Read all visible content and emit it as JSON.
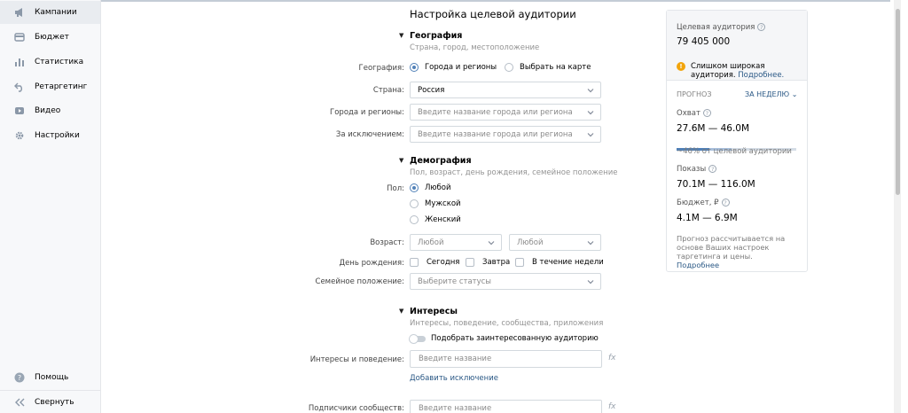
{
  "sidebar": {
    "items": [
      {
        "label": "Кампании",
        "icon": "megaphone-icon"
      },
      {
        "label": "Бюджет",
        "icon": "wallet-icon"
      },
      {
        "label": "Статистика",
        "icon": "bar-chart-icon"
      },
      {
        "label": "Ретаргетинг",
        "icon": "retarget-icon"
      },
      {
        "label": "Видео",
        "icon": "video-icon"
      },
      {
        "label": "Настройки",
        "icon": "gear-icon"
      }
    ],
    "help": "Помощь",
    "collapse": "Свернуть"
  },
  "page_title": "Настройка целевой аудитории",
  "geo": {
    "title": "География",
    "subtitle": "Страна, город, местоположение",
    "geo_label": "География:",
    "option_regions": "Города и регионы",
    "option_map": "Выбрать на карте",
    "country_label": "Страна:",
    "country_value": "Россия",
    "cities_label": "Города и регионы:",
    "cities_placeholder": "Введите название города или региона",
    "exclude_label": "За исключением:",
    "exclude_placeholder": "Введите название города или региона"
  },
  "demo": {
    "title": "Демография",
    "subtitle": "Пол, возраст, день рождения, семейное положение",
    "gender_label": "Пол:",
    "gender_any": "Любой",
    "gender_male": "Мужской",
    "gender_female": "Женский",
    "age_label": "Возраст:",
    "age_from": "Любой",
    "age_to": "Любой",
    "birthday_label": "День рождения:",
    "bday_today": "Сегодня",
    "bday_tomorrow": "Завтра",
    "bday_week": "В течение недели",
    "family_label": "Семейное положение:",
    "family_placeholder": "Выберите статусы"
  },
  "interests": {
    "title": "Интересы",
    "subtitle": "Интересы, поведение, сообщества, приложения",
    "toggle_label": "Подобрать заинтересованную аудиторию",
    "behavior_label": "Интересы и поведение:",
    "behavior_placeholder": "Введите название",
    "add_exclusion": "Добавить исключение",
    "subscribers_label": "Подписчики сообществ:",
    "subscribers_placeholder": "Введите название",
    "fx": "fx"
  },
  "panel": {
    "audience_label": "Целевая аудитория",
    "audience_value": "79 405 000",
    "warning_text": "Слишком широкая аудитория.",
    "warning_link": "Подробнее.",
    "forecast_label": "ПРОГНОЗ",
    "period": "ЗА НЕДЕЛЮ",
    "reach_label": "Охват",
    "reach_value": "27.6M — 46.0M",
    "reach_note": "~46% от целевой аудитории",
    "reach_share": 0.46,
    "impressions_label": "Показы",
    "impressions_value": "70.1M — 116.0M",
    "budget_label": "Бюджет, ₽",
    "budget_value": "4.1M — 6.9M",
    "note": "Прогноз рассчитывается на основе Ваших настроек таргетинга и цены.",
    "note_link": "Подробнее"
  },
  "colors": {
    "accent": "#5181b8",
    "link": "#2a5885",
    "warning": "#f2a40c"
  }
}
